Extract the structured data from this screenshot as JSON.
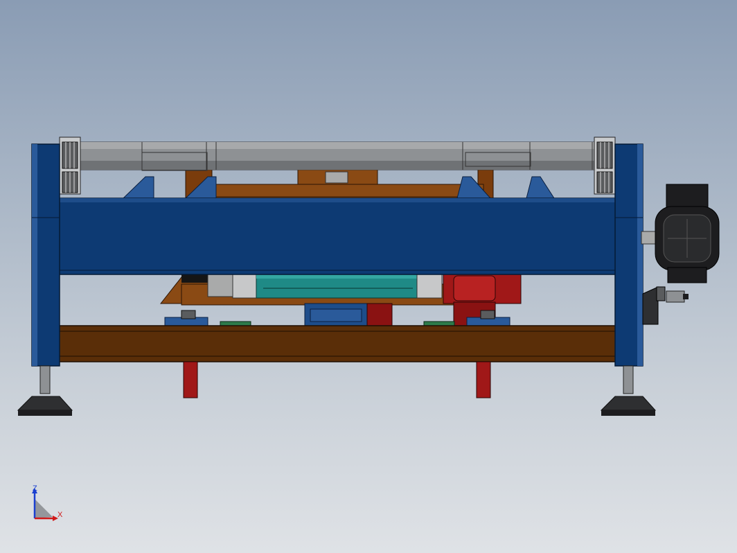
{
  "triad": {
    "z_label": "Z",
    "x_label": "X"
  },
  "colors": {
    "background_top": "#8a9cb4",
    "background_bottom": "#dfe2e6",
    "frame_blue": "#0d3a73",
    "frame_blue_light": "#2a5a9a",
    "brown": "#5a2e08",
    "orange_brown": "#9a5418",
    "roller_gray": "#8a8d90",
    "teal": "#1f8a86",
    "red": "#a01818",
    "motor_black": "#1d1d1f",
    "axis_z": "#1a3fd0",
    "axis_x": "#d01a1a"
  }
}
